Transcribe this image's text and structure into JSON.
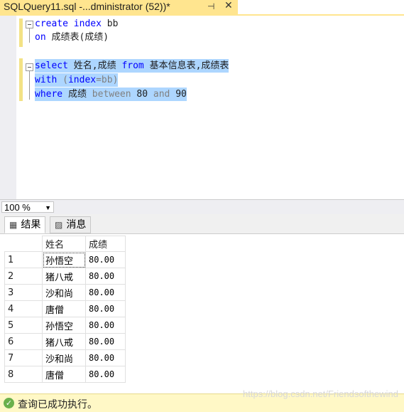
{
  "tab": {
    "title": "SQLQuery11.sql -...dministrator (52))*",
    "pin_icon": "pin-icon",
    "close_icon": "close-icon"
  },
  "editor": {
    "lines": [
      {
        "parts": [
          {
            "t": "create",
            "c": "kw"
          },
          {
            "t": " ",
            "c": "txt"
          },
          {
            "t": "index",
            "c": "kw"
          },
          {
            "t": " bb",
            "c": "txt"
          }
        ]
      },
      {
        "parts": [
          {
            "t": "on",
            "c": "kw"
          },
          {
            "t": " 成绩表(成绩)",
            "c": "txt"
          }
        ]
      },
      {
        "parts": []
      },
      {
        "parts": [
          {
            "t": "select",
            "c": "kw"
          },
          {
            "t": " 姓名,成绩 ",
            "c": "txt"
          },
          {
            "t": "from",
            "c": "kw"
          },
          {
            "t": " 基本信息表,成绩表",
            "c": "txt"
          }
        ]
      },
      {
        "parts": [
          {
            "t": "with",
            "c": "kw"
          },
          {
            "t": " (",
            "c": "gray"
          },
          {
            "t": "index",
            "c": "kw"
          },
          {
            "t": "=bb)",
            "c": "gray"
          }
        ]
      },
      {
        "parts": [
          {
            "t": "where",
            "c": "kw"
          },
          {
            "t": " 成绩 ",
            "c": "txt"
          },
          {
            "t": "between",
            "c": "gray"
          },
          {
            "t": " 80 ",
            "c": "txt"
          },
          {
            "t": "and",
            "c": "gray"
          },
          {
            "t": " 90",
            "c": "txt"
          }
        ]
      }
    ]
  },
  "zoom": {
    "value": "100 %"
  },
  "results_tabs": [
    {
      "label": "结果",
      "icon": "grid-icon"
    },
    {
      "label": "消息",
      "icon": "message-icon"
    }
  ],
  "grid": {
    "columns": [
      "姓名",
      "成绩"
    ],
    "rows": [
      {
        "n": "1",
        "name": "孙悟空",
        "score": "80.00"
      },
      {
        "n": "2",
        "name": "猪八戒",
        "score": "80.00"
      },
      {
        "n": "3",
        "name": "沙和尚",
        "score": "80.00"
      },
      {
        "n": "4",
        "name": "唐僧",
        "score": "80.00"
      },
      {
        "n": "5",
        "name": "孙悟空",
        "score": "80.00"
      },
      {
        "n": "6",
        "name": "猪八戒",
        "score": "80.00"
      },
      {
        "n": "7",
        "name": "沙和尚",
        "score": "80.00"
      },
      {
        "n": "8",
        "name": "唐僧",
        "score": "80.00"
      }
    ]
  },
  "status": {
    "text": "查询已成功执行。",
    "icon": "success-check-icon"
  },
  "watermark": "https://blog.csdn.net/Friendsofthewind"
}
